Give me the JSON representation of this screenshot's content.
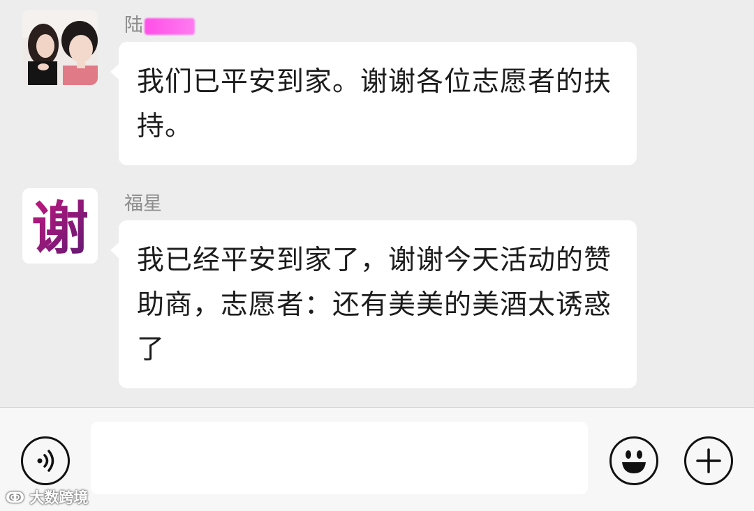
{
  "messages": [
    {
      "sender": "陆",
      "text": "我们已平安到家。谢谢各位志愿者的扶持。",
      "avatar_icon": "photo-avatar-two-women"
    },
    {
      "sender": "福星",
      "text": "我已经平安到家了，谢谢今天活动的赞助商，志愿者：还有美美的美酒太诱惑了",
      "avatar_icon": "calligraphy-xie-avatar",
      "avatar_char": "谢"
    }
  ],
  "input_bar": {
    "voice_icon": "voice-icon",
    "emoji_icon": "emoji-icon",
    "plus_icon": "plus-icon"
  },
  "watermark": "大数跨境",
  "colors": {
    "background": "#ededed",
    "bubble": "#ffffff",
    "sender_text": "#8c8c8c",
    "redaction": "#ff5ee9"
  }
}
